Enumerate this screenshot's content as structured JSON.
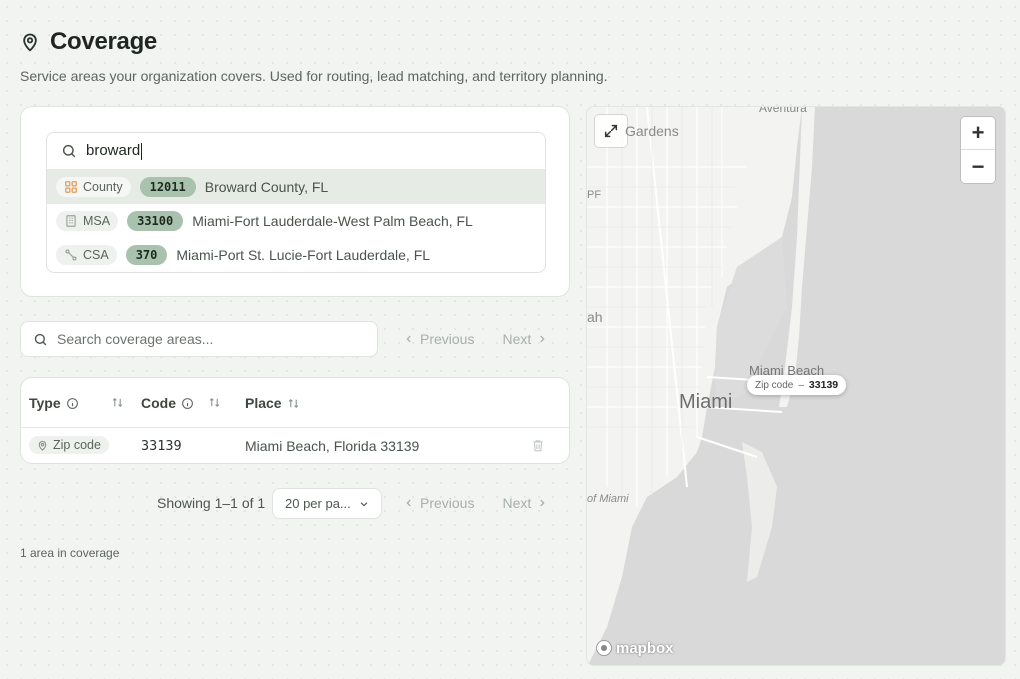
{
  "page": {
    "title": "Coverage",
    "subtitle": "Service areas your organization covers. Used for routing, lead matching, and territory planning."
  },
  "area_search": {
    "query": "broward",
    "results": [
      {
        "type": "County",
        "code": "12011",
        "label": "Broward County, FL",
        "icon": "grid-icon"
      },
      {
        "type": "MSA",
        "code": "33100",
        "label": "Miami-Fort Lauderdale-West Palm Beach, FL",
        "icon": "building-icon"
      },
      {
        "type": "CSA",
        "code": "370",
        "label": "Miami-Port St. Lucie-Fort Lauderdale, FL",
        "icon": "route-icon"
      }
    ]
  },
  "coverage_list": {
    "search_placeholder": "Search coverage areas...",
    "prev_label": "Previous",
    "next_label": "Next",
    "columns": {
      "type": "Type",
      "code": "Code",
      "place": "Place"
    },
    "rows": [
      {
        "type": "Zip code",
        "code": "33139",
        "place": "Miami Beach, Florida 33139"
      }
    ],
    "showing": "Showing 1–1 of 1",
    "per_page": "20 per pa...",
    "count_text": "1 area in coverage"
  },
  "map": {
    "labels": {
      "aventura": "Aventura",
      "gardens": "Gardens",
      "pf": "PF",
      "ah": "ah",
      "miami_beach": "Miami Beach",
      "miami": "Miami",
      "of_miami": "of Miami"
    },
    "marker": {
      "type": "Zip code",
      "sep": "–",
      "code": "33139"
    },
    "zoom_in": "+",
    "zoom_out": "−",
    "attribution": "mapbox"
  },
  "colors": {
    "accent_badge": "#a9c2ad",
    "active_row": "#e6ebe5",
    "map_land": "#dcdcdc"
  }
}
